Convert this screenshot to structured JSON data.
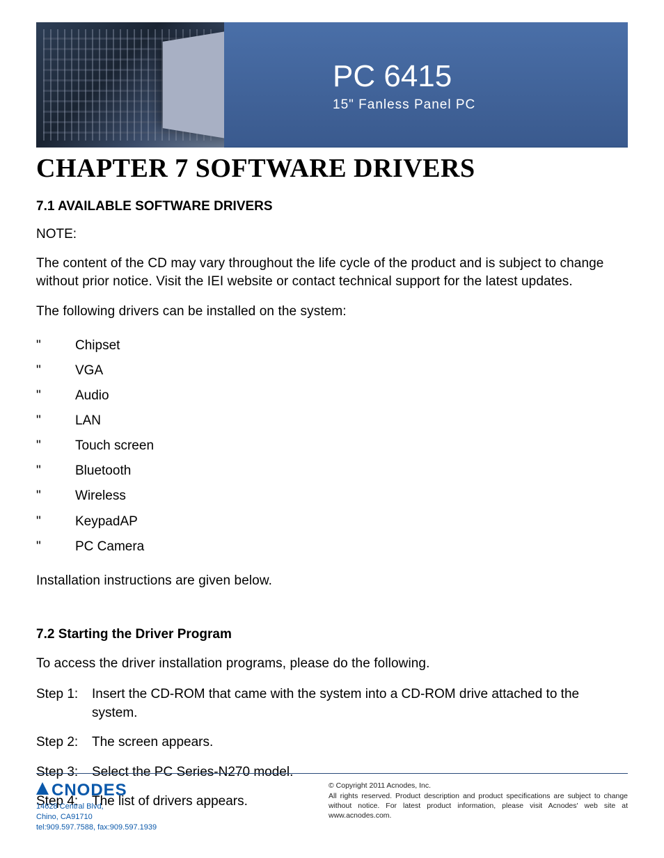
{
  "header": {
    "title": "PC 6415",
    "subtitle": "15\" Fanless Panel PC"
  },
  "chapter": {
    "title": "CHAPTER 7 SOFTWARE DRIVERS"
  },
  "section1": {
    "heading": "7.1 AVAILABLE SOFTWARE DRIVERS",
    "note_label": "NOTE:",
    "para1": "The content of the CD may vary throughout the life cycle of the product and is subject to change without prior notice. Visit the IEI website or contact technical support for the latest updates.",
    "para2": "The following drivers can be installed on the system:",
    "bullet": "\"",
    "drivers": [
      "Chipset",
      "VGA",
      "Audio",
      "LAN",
      "Touch screen",
      "Bluetooth",
      "Wireless",
      "KeypadAP",
      "PC Camera"
    ],
    "para3": "Installation instructions are given below."
  },
  "section2": {
    "heading": "7.2 Starting the Driver Program",
    "intro": "To access the driver installation programs, please do the following.",
    "steps": [
      {
        "label": "Step 1:",
        "text": "Insert the CD-ROM that came with the system into a CD-ROM drive attached to the system."
      },
      {
        "label": "Step 2:",
        "text": "The screen appears."
      },
      {
        "label": "Step 3:",
        "text": "Select the PC Series-N270 model."
      },
      {
        "label": "Step 4:",
        "text": "The list of drivers appears."
      }
    ]
  },
  "footer": {
    "logo": "CNODES",
    "address1": "14628 Central Blvd,",
    "address2": "Chino, CA91710",
    "phone": "tel:909.597.7588, fax:909.597.1939",
    "copyright": "© Copyright 2011 Acnodes, Inc.",
    "legal": "All rights reserved. Product description and product specifications are subject to change without notice. For latest product information, please visit Acnodes' web site at www.acnodes.com."
  }
}
